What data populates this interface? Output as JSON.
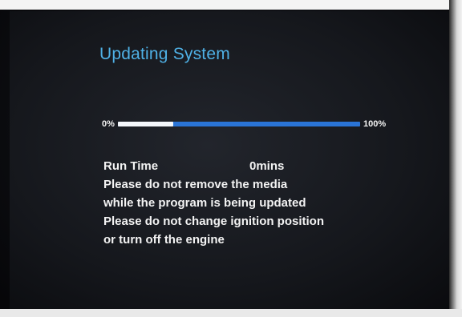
{
  "screen": {
    "title": "Updating System",
    "progress": {
      "min_label": "0%",
      "max_label": "100%",
      "fraction": 0.23
    },
    "run_time": {
      "label": "Run Time",
      "value": "0mins"
    },
    "messages": [
      "Please do not remove the media",
      "while the program is being updated",
      "Please do not change ignition position",
      "or turn off the engine"
    ]
  },
  "colors": {
    "title": "#4fb1e6",
    "bar": "#2a74d6",
    "bar_fill": "#f4f7fb",
    "text": "#f3f3f3"
  }
}
